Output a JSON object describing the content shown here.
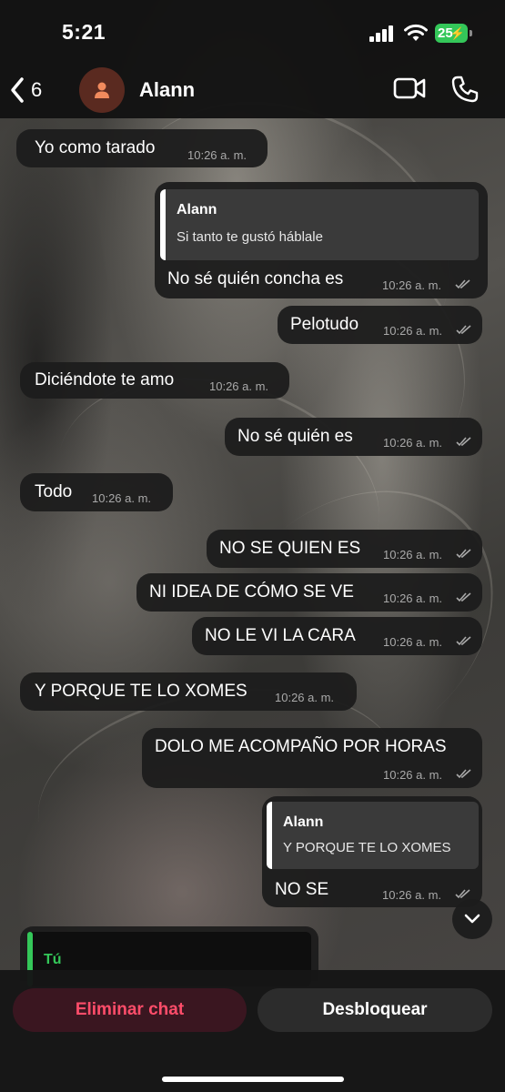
{
  "status_bar": {
    "time": "5:21",
    "battery": "25"
  },
  "header": {
    "back_count": "6",
    "contact_name": "Alann"
  },
  "messages": [
    {
      "text": "Yo como tarado",
      "time": "10:26 a. m."
    },
    {
      "quote_name": "Alann",
      "quote_text": "Si tanto te gustó háblale",
      "text": "No sé quién concha es",
      "time": "10:26 a. m."
    },
    {
      "text": "Pelotudo",
      "time": "10:26 a. m."
    },
    {
      "text": "Diciéndote te amo",
      "time": "10:26 a. m."
    },
    {
      "text": "No sé quién es",
      "time": "10:26 a. m."
    },
    {
      "text": "Todo",
      "time": "10:26 a. m."
    },
    {
      "text": "NO SE QUIEN ES",
      "time": "10:26 a. m."
    },
    {
      "text": "NI IDEA DE CÓMO SE VE",
      "time": "10:26 a. m."
    },
    {
      "text": "NO LE VI LA CARA",
      "time": "10:26 a. m."
    },
    {
      "text": "Y PORQUE TE LO XOMES",
      "time": "10:26 a. m."
    },
    {
      "text": "DOLO ME ACOMPAÑO POR HORAS",
      "time": "10:26 a. m."
    },
    {
      "quote_name": "Alann",
      "quote_text": "Y PORQUE TE LO XOMES",
      "text": "NO SE",
      "time": "10:26 a. m."
    }
  ],
  "partial_message": {
    "quote_name": "Tú"
  },
  "actions": {
    "delete_label": "Eliminar chat",
    "unblock_label": "Desbloquear"
  },
  "colors": {
    "accent_green": "#34c759",
    "delete_red": "#ff4d6a",
    "bubble": "#1c1c1c"
  }
}
